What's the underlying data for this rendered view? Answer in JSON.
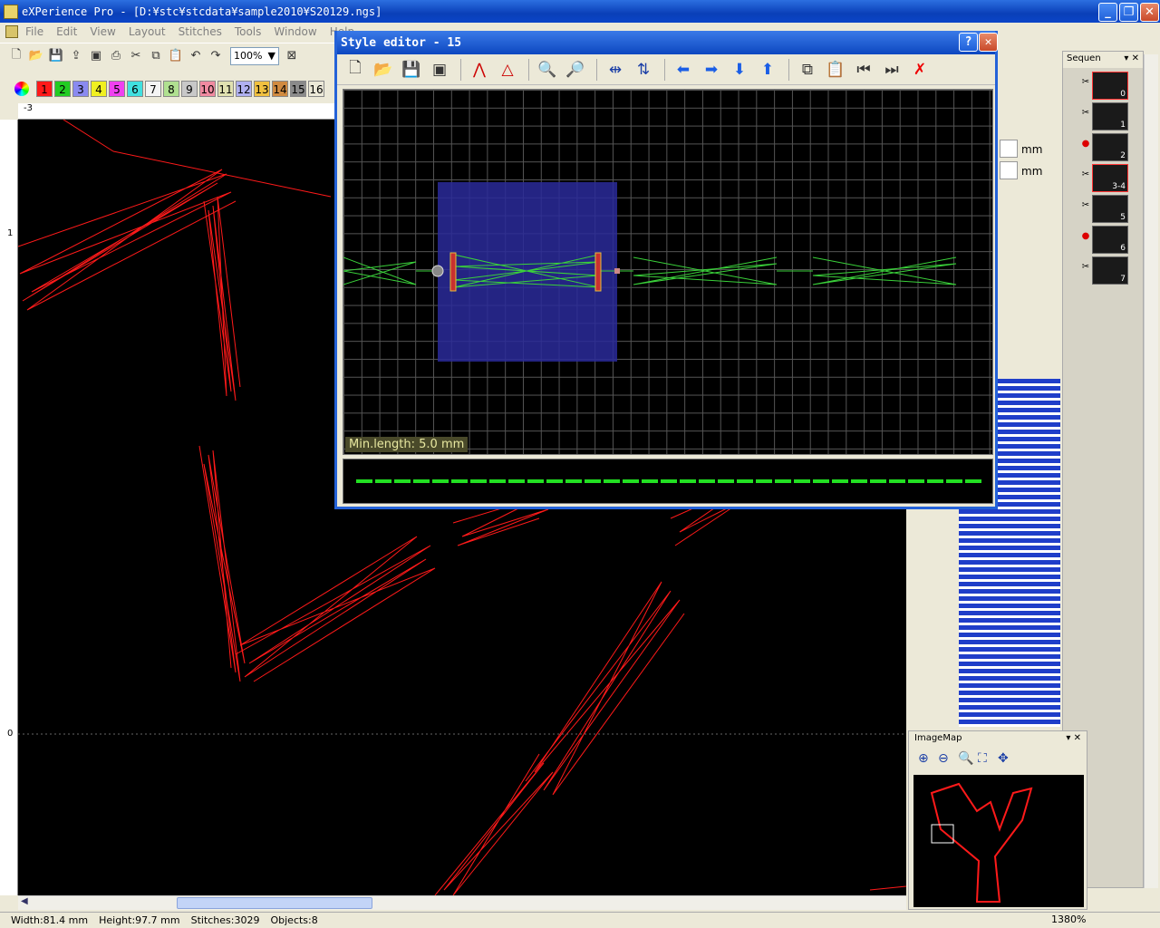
{
  "app": {
    "title": "eXPerience Pro - [D:¥stc¥stcdata¥sample2010¥S20129.ngs]",
    "minimize": "_",
    "restore": "❐",
    "close": "✕"
  },
  "menu": [
    "File",
    "Edit",
    "View",
    "Layout",
    "Stitches",
    "Tools",
    "Window",
    "Help"
  ],
  "toolbar": {
    "zoom": "100%"
  },
  "colors": [
    {
      "n": "1",
      "c": "#ff1a1a"
    },
    {
      "n": "2",
      "c": "#22cc22"
    },
    {
      "n": "3",
      "c": "#8a8af0"
    },
    {
      "n": "4",
      "c": "#f0f020"
    },
    {
      "n": "5",
      "c": "#f040f0"
    },
    {
      "n": "6",
      "c": "#40e0e0"
    },
    {
      "n": "7",
      "c": "#f4f4f4"
    },
    {
      "n": "8",
      "c": "#b0e090"
    },
    {
      "n": "9",
      "c": "#c8c8c8"
    },
    {
      "n": "10",
      "c": "#f08aa0"
    },
    {
      "n": "11",
      "c": "#e0e0b0"
    },
    {
      "n": "12",
      "c": "#b0b0f0"
    },
    {
      "n": "13",
      "c": "#f0c040"
    },
    {
      "n": "14",
      "c": "#d08a40"
    },
    {
      "n": "15",
      "c": "#8a8a8a"
    },
    {
      "n": "16",
      "c": "#ece9d8"
    }
  ],
  "ruler": {
    "h_start": "-3",
    "v_marks": [
      "1",
      "0"
    ]
  },
  "status": {
    "width": "Width:81.4 mm",
    "height": "Height:97.7 mm",
    "stitches": "Stitches:3029",
    "objects": "Objects:8"
  },
  "right_panel": {
    "unit1": "mm",
    "unit2": "mm"
  },
  "sequence": {
    "title": "Sequen",
    "items": [
      "0",
      "1",
      "2",
      "3-4",
      "5",
      "6",
      "7"
    ]
  },
  "imagemap": {
    "title": "ImageMap",
    "zoom": "1380%"
  },
  "style_editor": {
    "title": "Style editor - 15",
    "help": "?",
    "close": "✕",
    "min_length": "Min.length: 5.0 mm"
  }
}
